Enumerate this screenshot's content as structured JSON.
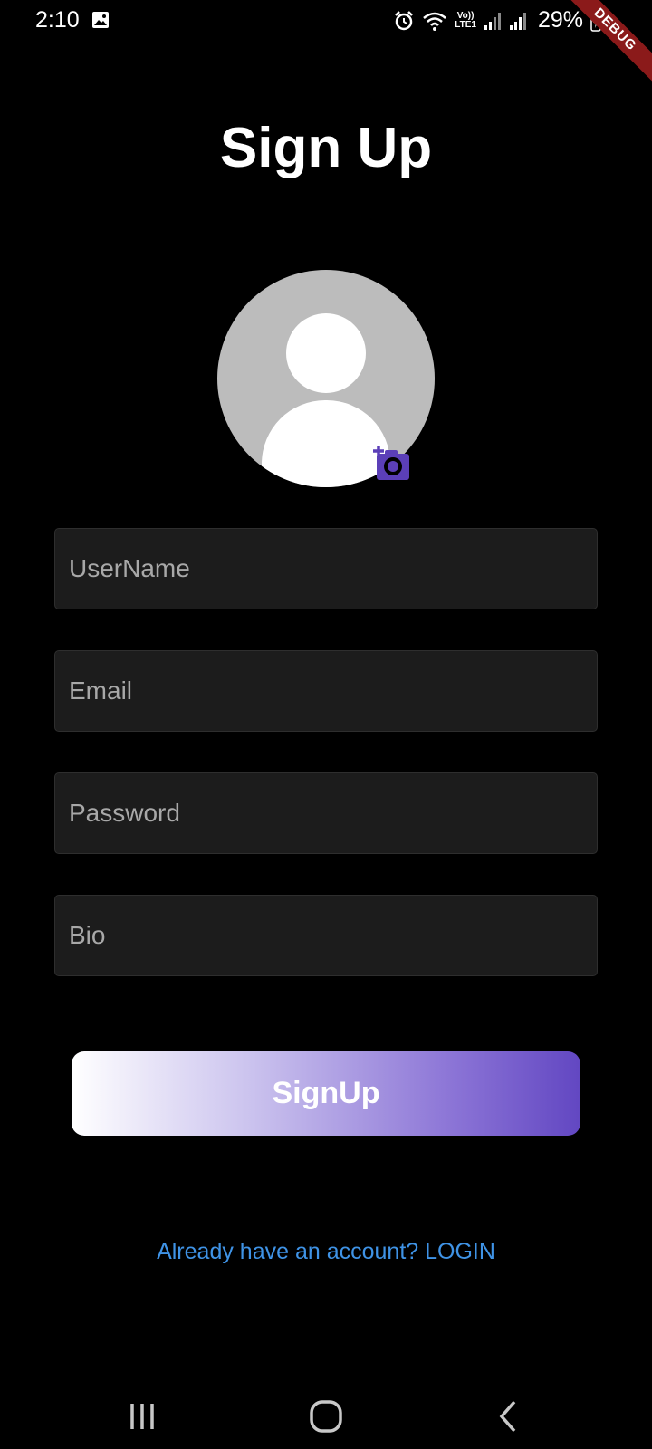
{
  "status_bar": {
    "time": "2:10",
    "network_label": "Vo))\nLTE1",
    "battery": "29%",
    "icons": [
      "gallery-icon",
      "alarm-icon",
      "wifi-icon",
      "signal-icon",
      "signal-icon",
      "battery-charging-icon"
    ]
  },
  "debug_banner": "DEBUG",
  "title": "Sign Up",
  "form": {
    "username_placeholder": "UserName",
    "email_placeholder": "Email",
    "password_placeholder": "Password",
    "bio_placeholder": "Bio"
  },
  "signup_label": "SignUp",
  "login_link": "Already have an account? LOGIN",
  "colors": {
    "background": "#000000",
    "field_bg": "#1c1c1c",
    "accent_purple": "#6247c2",
    "link_blue": "#3f93e6"
  },
  "nav_bar": [
    "recents-icon",
    "home-icon",
    "back-icon"
  ]
}
